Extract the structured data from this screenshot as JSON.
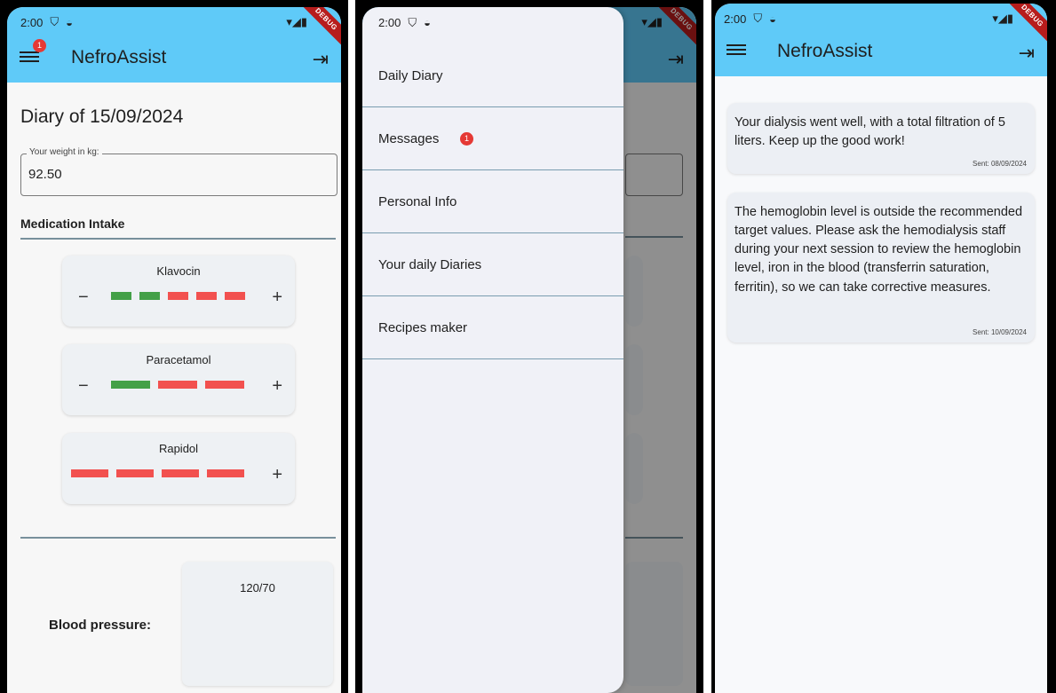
{
  "app": {
    "title": "NefroAssist",
    "status_time": "2:00",
    "debug_label": "DEBUG",
    "notification_badge": "1"
  },
  "diary": {
    "title": "Diary of 15/09/2024",
    "weight_label": "Your weight in kg:",
    "weight_value": "92.50",
    "medication_section": "Medication Intake",
    "medications": [
      {
        "name": "Klavocin",
        "bars": [
          "green",
          "green",
          "red",
          "red",
          "red"
        ]
      },
      {
        "name": "Paracetamol",
        "bars": [
          "green",
          "red",
          "red"
        ]
      },
      {
        "name": "Rapidol",
        "bars": [
          "red",
          "red",
          "red",
          "red"
        ]
      }
    ],
    "blood_pressure_label": "Blood pressure:",
    "blood_pressure_value": "120/70"
  },
  "drawer": {
    "items": [
      {
        "label": "Daily Diary"
      },
      {
        "label": "Messages",
        "badge": "1"
      },
      {
        "label": "Personal Info"
      },
      {
        "label": "Your daily Diaries"
      },
      {
        "label": "Recipes maker"
      }
    ]
  },
  "messages": [
    {
      "text": "Your dialysis went well, with a total filtration of 5 liters. Keep up the good work!",
      "sent": "Sent: 08/09/2024"
    },
    {
      "text": "The hemoglobin level is outside the recommended target values. Please ask the hemodialysis staff during your next session to review the hemoglobin level, iron in the blood (transferrin saturation, ferritin), so we can take corrective measures.",
      "sent": "Sent: 10/09/2024"
    }
  ],
  "colors": {
    "appbar": "#5fcaf8",
    "green": "#43a047",
    "red": "#f2514f",
    "badge": "#e53935",
    "divider": "#78909c"
  }
}
